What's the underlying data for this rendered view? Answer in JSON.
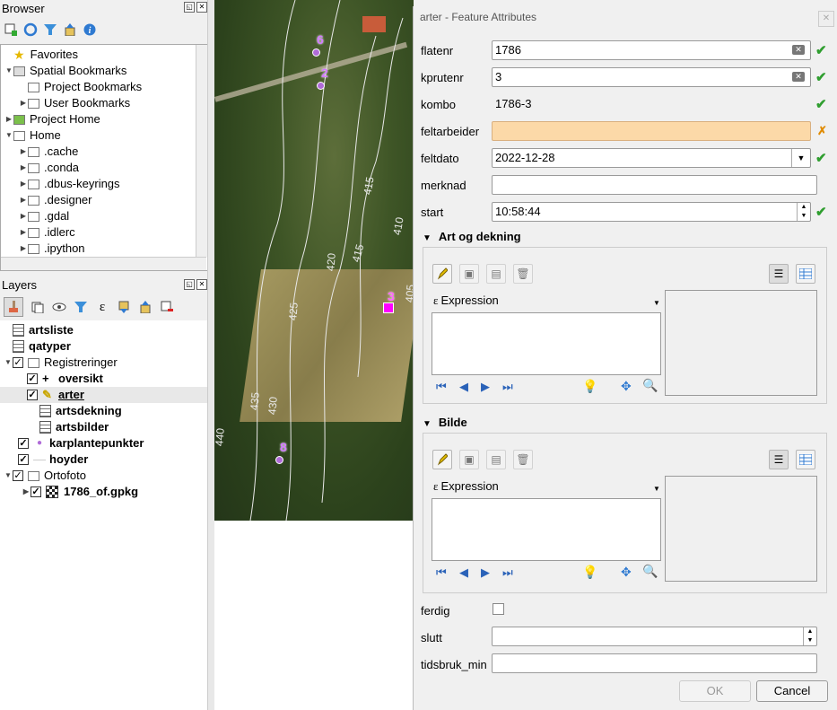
{
  "browser": {
    "title": "Browser",
    "items": [
      {
        "label": "Favorites"
      },
      {
        "label": "Spatial Bookmarks"
      },
      {
        "label": "Project Bookmarks"
      },
      {
        "label": "User Bookmarks"
      },
      {
        "label": "Project Home"
      },
      {
        "label": "Home"
      },
      {
        "label": ".cache"
      },
      {
        "label": ".conda"
      },
      {
        "label": ".dbus-keyrings"
      },
      {
        "label": ".designer"
      },
      {
        "label": ".gdal"
      },
      {
        "label": ".idlerc"
      },
      {
        "label": ".ipython"
      }
    ]
  },
  "layers": {
    "title": "Layers",
    "items": [
      {
        "label": "artsliste"
      },
      {
        "label": "qatyper"
      },
      {
        "label": "Registreringer"
      },
      {
        "label": "oversikt"
      },
      {
        "label": "arter"
      },
      {
        "label": "artsdekning"
      },
      {
        "label": "artsbilder"
      },
      {
        "label": "karplantepunkter"
      },
      {
        "label": "hoyder"
      },
      {
        "label": "Ortofoto"
      },
      {
        "label": "1786_of.gpkg"
      }
    ]
  },
  "map": {
    "contours": [
      "415",
      "410",
      "415",
      "420",
      "425",
      "430",
      "435",
      "440",
      "405"
    ],
    "points": [
      "6",
      "2",
      "3",
      "8"
    ]
  },
  "dialog": {
    "title": "arter - Feature Attributes",
    "fields": {
      "flatenr": {
        "label": "flatenr",
        "value": "1786"
      },
      "kprutenr": {
        "label": "kprutenr",
        "value": "3"
      },
      "kombo": {
        "label": "kombo",
        "value": "1786-3"
      },
      "feltarbeider": {
        "label": "feltarbeider",
        "value": ""
      },
      "feltdato": {
        "label": "feltdato",
        "value": "2022-12-28"
      },
      "merknad": {
        "label": "merknad",
        "value": ""
      },
      "start": {
        "label": "start",
        "value": "10:58:44"
      },
      "ferdig": {
        "label": "ferdig"
      },
      "slutt": {
        "label": "slutt",
        "value": ""
      },
      "tidsbruk_min": {
        "label": "tidsbruk_min",
        "value": ""
      }
    },
    "sections": [
      {
        "title": "Art og dekning",
        "expression": "Expression"
      },
      {
        "title": "Bilde",
        "expression": "Expression"
      }
    ],
    "buttons": {
      "ok": "OK",
      "cancel": "Cancel"
    },
    "colors": {
      "valid": "#2f9e2f",
      "warning": "#e08b00",
      "required_bg": "#fcd9a8"
    }
  }
}
